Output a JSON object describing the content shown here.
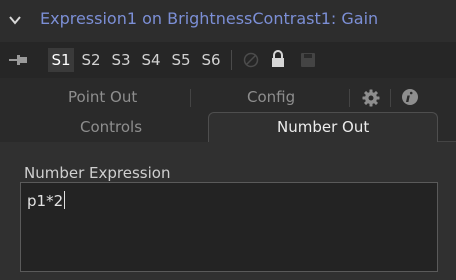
{
  "window": {
    "title": "Expression1 on BrightnessContrast1: Gain"
  },
  "toolbar": {
    "slots": [
      "S1",
      "S2",
      "S3",
      "S4",
      "S5",
      "S6"
    ],
    "active_slot": "S1"
  },
  "tabs": {
    "row1": [
      "Point Out",
      "Config"
    ],
    "row2": [
      "Controls",
      "Number Out"
    ],
    "active": "Number Out"
  },
  "field": {
    "label": "Number Expression",
    "value": "p1*2"
  },
  "colors": {
    "title_accent": "#7c8fd6",
    "background": "#2a2a2a",
    "panel": "#303030"
  },
  "icons": [
    "chevron-down-icon",
    "pin-icon",
    "no-entry-icon",
    "lock-icon",
    "save-icon",
    "gear-icon",
    "info-icon"
  ]
}
